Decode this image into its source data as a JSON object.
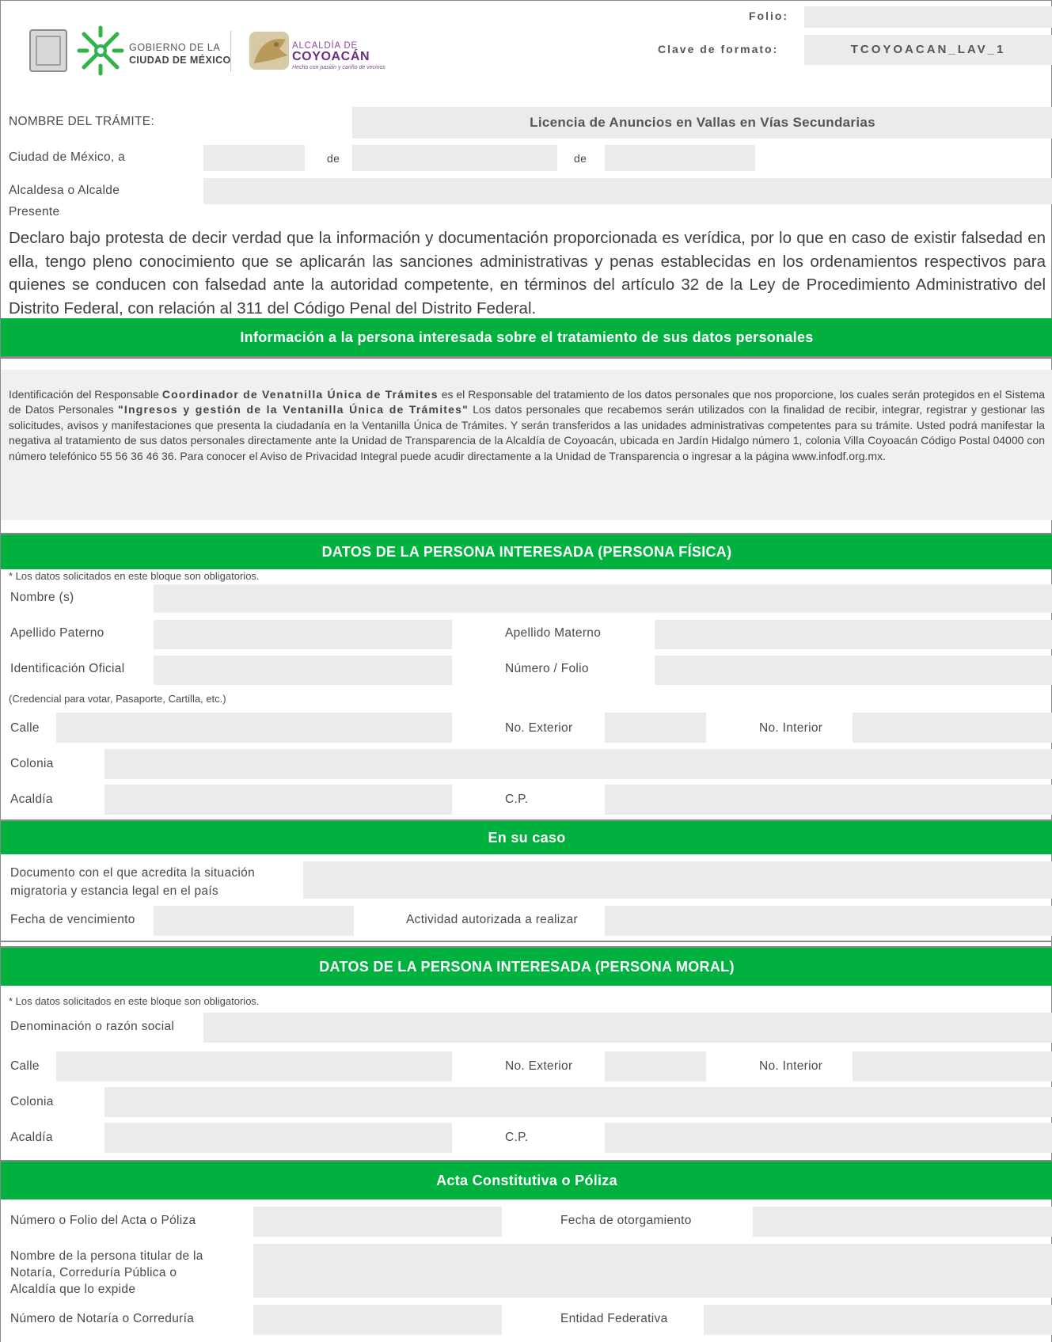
{
  "header": {
    "folio_label": "Folio:",
    "folio_value": "",
    "clave_label": "Clave de formato:",
    "clave_value": "TCOYOACAN_LAV_1",
    "gob_line1": "GOBIERNO DE LA",
    "gob_line2": "CIUDAD DE MÉXICO",
    "coy_line1": "ALCALDÍA DE",
    "coy_line2": "COYOACÁN",
    "coy_tagline": "Hecho con pasión y cariño de vecinos"
  },
  "tramite": {
    "label": "NOMBRE DEL TRÁMITE:",
    "value": "Licencia de Anuncios en Vallas en Vías Secundarias"
  },
  "fecha": {
    "label": "Ciudad de México, a",
    "de1": "de",
    "de2": "de",
    "dia": "",
    "mes": "",
    "anio": ""
  },
  "alcalde": {
    "label": "Alcaldesa o Alcalde",
    "presente": "Presente"
  },
  "declaration": "Declaro bajo protesta de decir verdad que la información y documentación proporcionada es verídica, por lo que en caso de existir falsedad en ella, tengo pleno conocimiento que se aplicarán las sanciones administrativas y penas establecidas en los ordenamientos respectivos para quienes se conducen con falsedad ante la autoridad competente, en términos del artículo 32 de la Ley de Procedimiento Administrativo del Distrito Federal, con relación al 311 del Código Penal del Distrito Federal.",
  "privacy": {
    "title": "Información a la persona interesada sobre el tratamiento de sus datos personales",
    "t1": "Identificación del Responsable ",
    "b1": "Coordinador de Venatnilla Única de Trámites",
    "t2": " es el Responsable del tratamiento de los datos personales que nos proporcione, los cuales serán protegidos en el Sistema de Datos Personales ",
    "b2": "\"Ingresos y gestión de la Ventanilla Única de Trámites\"",
    "t3": " Los datos personales que recabemos serán utilizados con la finalidad de recibir, integrar, registrar y gestionar las solicitudes, avisos y manifestaciones que presenta la ciudadanía en la Ventanilla Única de Trámites. Y serán transferidos a las unidades administrativas competentes para su trámite. Usted podrá manifestar la negativa al tratamiento de sus datos personales directamente ante la Unidad de Transparencia de la Alcaldía de Coyoacán, ubicada en Jardín Hidalgo número 1, colonia Villa Coyoacán Código Postal 04000 con número telefónico 55 56 36 46 36. Para conocer el Aviso de Privacidad Integral puede acudir directamente a la Unidad de Transparencia o ingresar a la página www.infodf.org.mx."
  },
  "fisica": {
    "title": "DATOS DE LA PERSONA INTERESADA (PERSONA FÍSICA)",
    "note": "* Los datos solicitados en este bloque son obligatorios.",
    "nombre": "Nombre (s)",
    "ap_paterno": "Apellido Paterno",
    "ap_materno": "Apellido Materno",
    "identificacion": "Identificación Oficial",
    "numero_folio": "Número / Folio",
    "ident_note": "(Credencial para votar, Pasaporte, Cartilla, etc.)",
    "calle": "Calle",
    "no_exterior": "No. Exterior",
    "no_interior": "No. Interior",
    "colonia": "Colonia",
    "alcaldia": "Acaldía",
    "cp": "C.P."
  },
  "en_su_caso": {
    "title": "En su caso",
    "documento_l1": "Documento con el que acredita la situación",
    "documento_l2": "migratoria y estancia legal en el país",
    "vencimiento": "Fecha de vencimiento",
    "actividad": "Actividad autorizada a realizar"
  },
  "moral": {
    "title": "DATOS DE LA PERSONA INTERESADA (PERSONA MORAL)",
    "note": "* Los datos solicitados en este bloque son obligatorios.",
    "denominacion": "Denominación o razón social",
    "calle": "Calle",
    "no_exterior": "No. Exterior",
    "no_interior": "No. Interior",
    "colonia": "Colonia",
    "alcaldia": "Acaldía",
    "cp": "C.P."
  },
  "acta": {
    "title": "Acta Constitutiva o Póliza",
    "numero": "Número o Folio del Acta o Póliza",
    "fecha": "Fecha de otorgamiento",
    "titular_l1": "Nombre de la persona titular de la",
    "titular_l2": "Notaría, Correduría Pública o",
    "titular_l3": "Alcaldía que lo expide",
    "no_notaria": "Número de Notaría o Correduría",
    "entidad": "Entidad Federativa"
  }
}
